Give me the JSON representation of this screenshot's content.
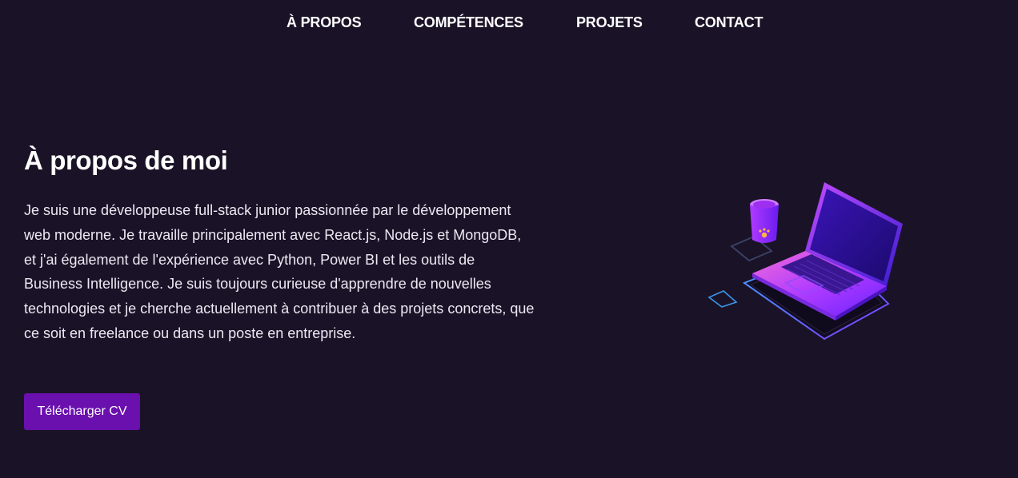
{
  "nav": {
    "items": [
      {
        "label": "À PROPOS"
      },
      {
        "label": "COMPÉTENCES"
      },
      {
        "label": "PROJETS"
      },
      {
        "label": "CONTACT"
      }
    ]
  },
  "about": {
    "title": "À propos de moi",
    "description": "Je suis une développeuse full-stack junior passionnée par le développement web moderne. Je travaille principalement avec React.js, Node.js et MongoDB, et j'ai également de l'expérience avec Python, Power BI et les outils de Business Intelligence. Je suis toujours curieuse d'apprendre de nouvelles technologies et je cherche actuellement à contribuer à des projets concrets, que ce soit en freelance ou dans un poste en entreprise.",
    "button_label": "Télécharger CV"
  },
  "illustration": {
    "name": "laptop-with-coffee-cup-illustration"
  },
  "colors": {
    "background": "#1a1327",
    "button": "#6a10ae",
    "accent_purple": "#8b2cf5",
    "accent_blue": "#3fa3ff"
  }
}
